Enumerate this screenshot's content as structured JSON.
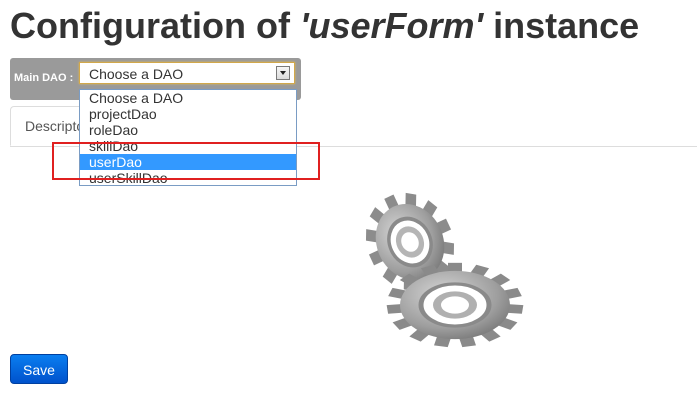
{
  "header": {
    "title_prefix": "Configuration of ",
    "instance_name": "'userForm'",
    "title_suffix": " instance"
  },
  "dao": {
    "label": "Main DAO :",
    "selected": "Choose a DAO",
    "options": [
      "Choose a DAO",
      "projectDao",
      "roleDao",
      "skillDao",
      "userDao",
      "userSkillDao"
    ],
    "highlighted_option": "userDao"
  },
  "tabs": [
    {
      "label": "Descriptor"
    }
  ],
  "save_label": "Save",
  "colors": {
    "save_button": "#0066dd",
    "dao_bar": "#9a9a9a",
    "option_highlight": "#3399ff",
    "annotation_box": "#e02020"
  },
  "icons": {
    "loading": "gears-icon"
  }
}
